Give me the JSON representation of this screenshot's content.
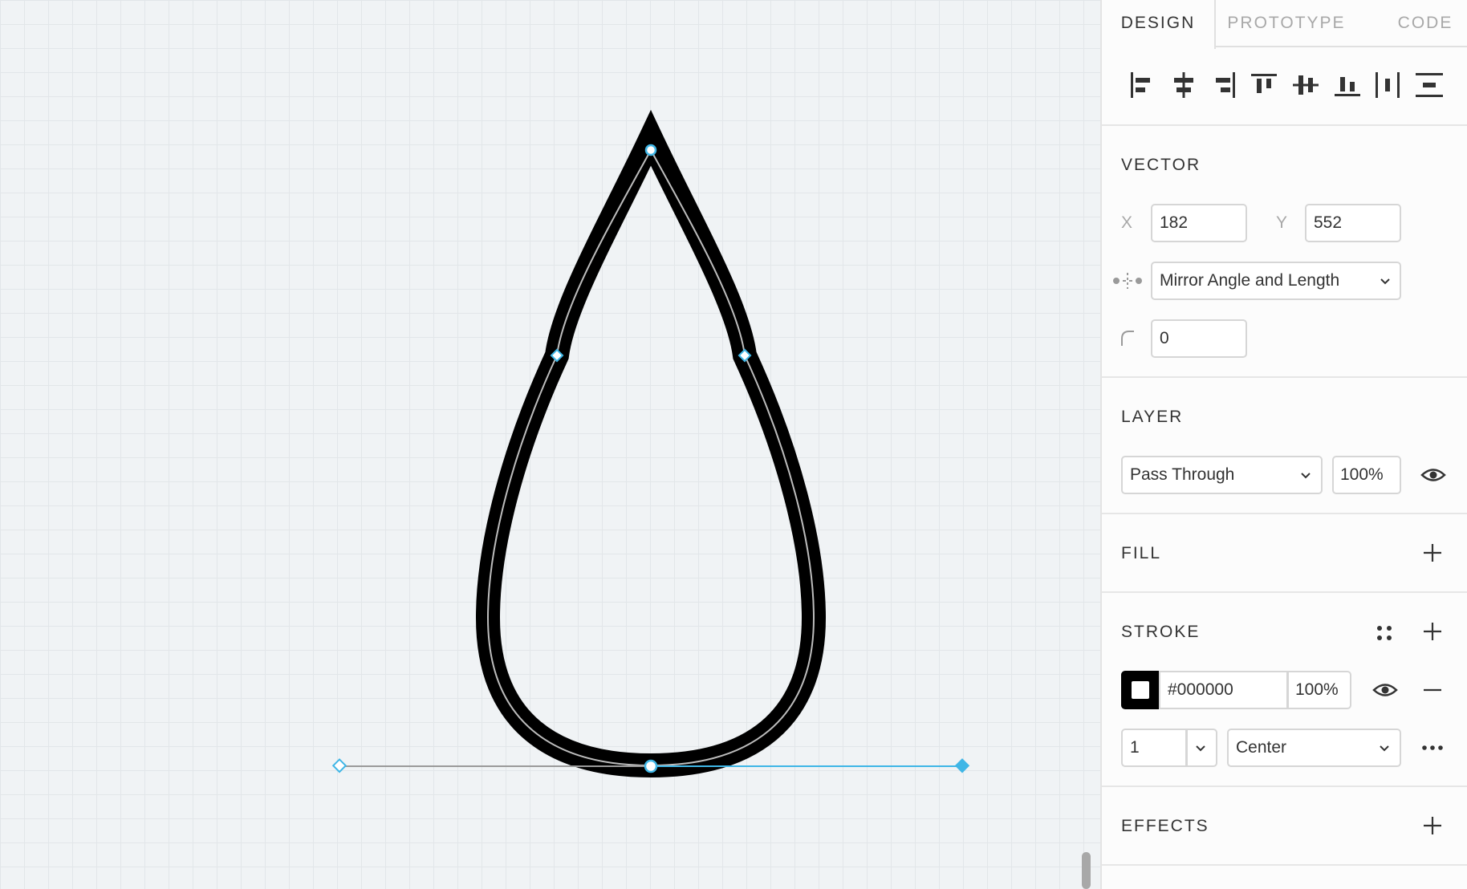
{
  "tabs": [
    {
      "label": "DESIGN",
      "active": true
    },
    {
      "label": "PROTOTYPE",
      "active": false
    },
    {
      "label": "CODE",
      "active": false
    }
  ],
  "align_tools": [
    "align-left-icon",
    "align-horizontal-center-icon",
    "align-right-icon",
    "align-top-icon",
    "align-vertical-center-icon",
    "align-bottom-icon",
    "distribute-horizontal-icon",
    "distribute-vertical-icon"
  ],
  "vector": {
    "title": "VECTOR",
    "x_label": "X",
    "x_value": "182",
    "y_label": "Y",
    "y_value": "552",
    "mirror_mode": "Mirror Angle and Length",
    "corner_radius": "0"
  },
  "layer": {
    "title": "LAYER",
    "blend_mode": "Pass Through",
    "opacity": "100%"
  },
  "fill": {
    "title": "FILL"
  },
  "stroke": {
    "title": "STROKE",
    "color_hex": "#000000",
    "opacity": "100%",
    "weight": "1",
    "position": "Center"
  },
  "effects": {
    "title": "EFFECTS"
  },
  "colors": {
    "accent": "#3fb6e6",
    "stroke": "#000000",
    "canvas_bg": "#f0f3f5",
    "panel_bg": "#fcfcfc"
  }
}
